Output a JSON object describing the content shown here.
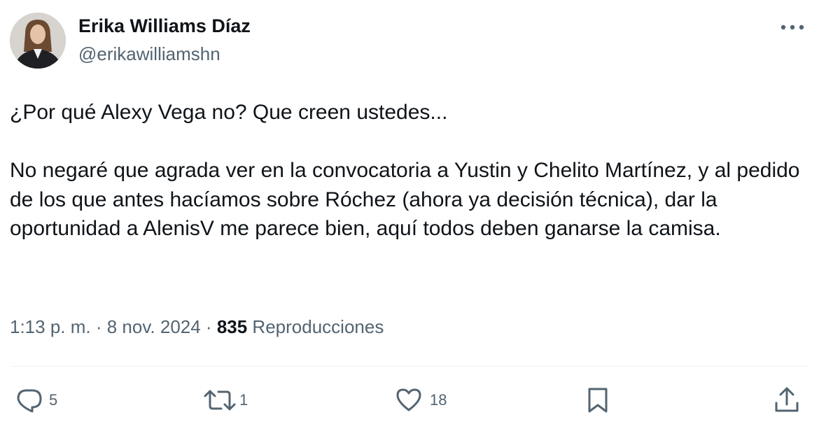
{
  "author": {
    "display_name": "Erika Williams Díaz",
    "handle": "@erikawilliamshn"
  },
  "tweet": {
    "paragraphs": [
      "¿Por qué Alexy Vega no? Que creen ustedes...",
      "No negaré que agrada ver en la convocatoria a Yustin y Chelito Martínez, y al pedido de los que antes hacíamos sobre Róchez (ahora ya decisión técnica), dar la oportunidad a AlenisV me parece bien, aquí todos deben ganarse la camisa."
    ]
  },
  "meta": {
    "time": "1:13 p. m.",
    "separator": " · ",
    "date": "8 nov. 2024",
    "views_count": "835",
    "views_label": " Reproducciones"
  },
  "actions": {
    "replies": "5",
    "retweets": "1",
    "likes": "18"
  },
  "icons": {
    "more": "more-horizontal-icon",
    "reply": "reply-icon",
    "retweet": "retweet-icon",
    "like": "heart-icon",
    "bookmark": "bookmark-icon",
    "share": "share-icon"
  },
  "colors": {
    "text_primary": "#0f1419",
    "text_secondary": "#536471",
    "divider": "#eff3f4"
  }
}
